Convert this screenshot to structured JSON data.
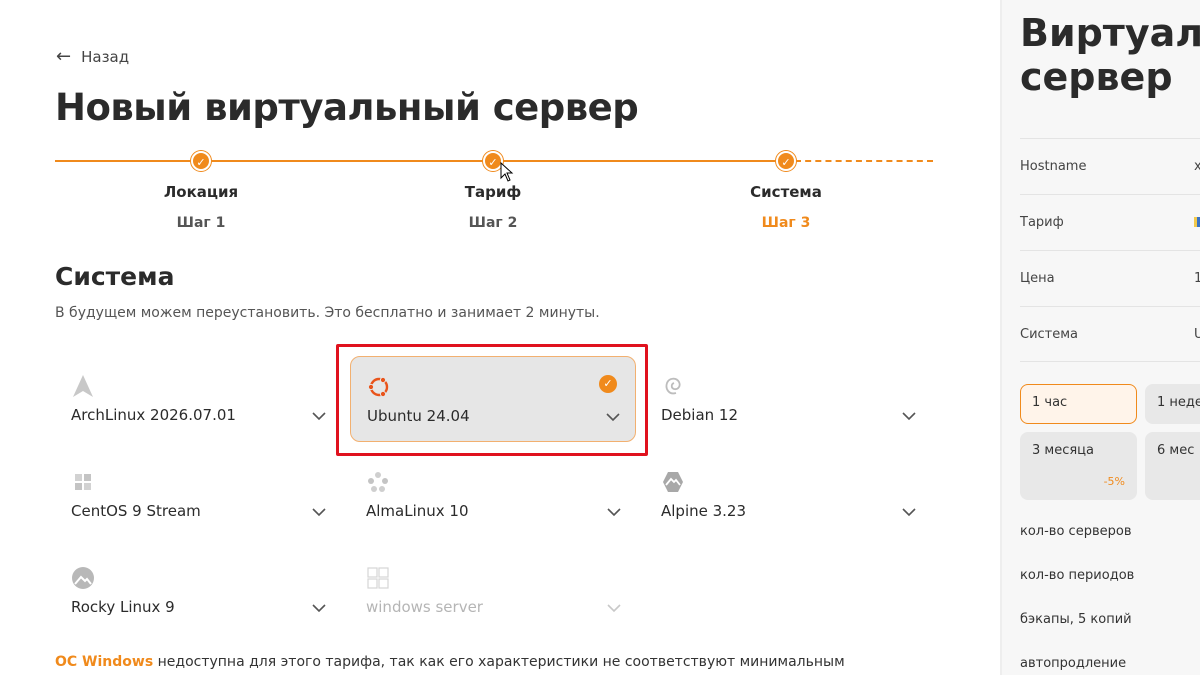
{
  "nav": {
    "back_label": "Назад",
    "back_arrow": "←"
  },
  "page": {
    "title": "Новый виртуальный сервер"
  },
  "steps": [
    {
      "name": "Локация",
      "num": "Шаг 1"
    },
    {
      "name": "Тариф",
      "num": "Шаг 2"
    },
    {
      "name": "Система",
      "num": "Шаг 3"
    }
  ],
  "section": {
    "title": "Система",
    "description": "В будущем можем переустановить. Это бесплатно и занимает 2 минуты."
  },
  "os_options": [
    {
      "name": "ArchLinux 2026.07.01",
      "icon": "archlinux-icon",
      "selected": false
    },
    {
      "name": "Ubuntu 24.04",
      "icon": "ubuntu-icon",
      "selected": true
    },
    {
      "name": "Debian 12",
      "icon": "debian-icon",
      "selected": false
    },
    {
      "name": "CentOS 9 Stream",
      "icon": "centos-icon",
      "selected": false
    },
    {
      "name": "AlmaLinux 10",
      "icon": "almalinux-icon",
      "selected": false
    },
    {
      "name": "Alpine 3.23",
      "icon": "alpine-icon",
      "selected": false
    },
    {
      "name": "Rocky Linux 9",
      "icon": "rocky-icon",
      "selected": false
    },
    {
      "name": "windows server",
      "icon": "windows-icon",
      "selected": false,
      "disabled": true
    }
  ],
  "note": {
    "accent": "ОС Windows",
    "text": " недоступна для этого тарифа, так как его характеристики не соответствуют минимальным"
  },
  "summary": {
    "title_line1": "Виртуаль",
    "title_line2": "сервер",
    "rows": [
      {
        "key": "Hostname",
        "value": "x"
      },
      {
        "key": "Тариф",
        "value": ""
      },
      {
        "key": "Цена",
        "value": "1"
      },
      {
        "key": "Система",
        "value": "U"
      }
    ],
    "periods": [
      {
        "label": "1 час",
        "discount": ""
      },
      {
        "label": "1 неде",
        "discount": ""
      },
      {
        "label": "3 месяца",
        "discount": "-5%"
      },
      {
        "label": "6 мес",
        "discount": ""
      }
    ],
    "labels": {
      "servers_count": "кол-во серверов",
      "periods_count": "кол-во периодов",
      "backups": "бэкапы, 5 копий",
      "autorenew": "автопродление"
    }
  },
  "colors": {
    "accent": "#f08a1c",
    "highlight": "#e0121e",
    "selected_bg": "#e6e6e6"
  }
}
